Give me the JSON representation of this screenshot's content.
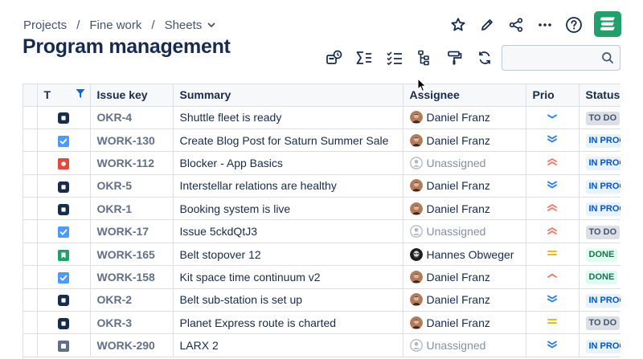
{
  "breadcrumb": {
    "items": [
      "Projects",
      "Fine work",
      "Sheets"
    ],
    "separator": "/"
  },
  "page_title": "Program management",
  "search": {
    "value": "",
    "placeholder": ""
  },
  "colors": {
    "brand_green": "#22A06B",
    "text": "#172B4D",
    "key_text": "#626F86",
    "unassigned": "#8590A2"
  },
  "columns": [
    "T",
    "Issue key",
    "Summary",
    "Assignee",
    "Prio",
    "Status"
  ],
  "rows": [
    {
      "type": "task-dark",
      "key": "OKR-4",
      "summary": "Shuttle fleet is ready",
      "assignee": "Daniel Franz",
      "avatar": "daniel",
      "prio": "low",
      "status": "TO DO",
      "status_kind": "todo"
    },
    {
      "type": "checked",
      "key": "WORK-130",
      "summary": "Create Blog Post for Saturn Summer Sale",
      "assignee": "Daniel Franz",
      "avatar": "daniel",
      "prio": "lowest",
      "status": "IN PROG",
      "status_kind": "progress"
    },
    {
      "type": "bug",
      "key": "WORK-112",
      "summary": "Blocker - App Basics",
      "assignee": "Unassigned",
      "avatar": "none",
      "prio": "highest",
      "status": "IN PROG",
      "status_kind": "progress"
    },
    {
      "type": "task-dark",
      "key": "OKR-5",
      "summary": "Interstellar relations are healthy",
      "assignee": "Daniel Franz",
      "avatar": "daniel",
      "prio": "lowest",
      "status": "IN PROG",
      "status_kind": "progress"
    },
    {
      "type": "task-dark",
      "key": "OKR-1",
      "summary": "Booking system is live",
      "assignee": "Daniel Franz",
      "avatar": "daniel",
      "prio": "highest",
      "status": "IN PROG",
      "status_kind": "progress"
    },
    {
      "type": "checked",
      "key": "WORK-17",
      "summary": "Issue 5ckdQtJ3",
      "assignee": "Unassigned",
      "avatar": "none",
      "prio": "highest",
      "status": "TO DO",
      "status_kind": "todo"
    },
    {
      "type": "story",
      "key": "WORK-165",
      "summary": "Belt stopover 12",
      "assignee": "Hannes Obweger",
      "avatar": "hannes",
      "prio": "medium",
      "status": "DONE",
      "status_kind": "done"
    },
    {
      "type": "checked",
      "key": "WORK-158",
      "summary": "Kit space time continuum v2",
      "assignee": "Daniel Franz",
      "avatar": "daniel",
      "prio": "high",
      "status": "DONE",
      "status_kind": "done"
    },
    {
      "type": "task-dark",
      "key": "OKR-2",
      "summary": "Belt sub-station is set up",
      "assignee": "Daniel Franz",
      "avatar": "daniel",
      "prio": "lowest",
      "status": "IN PROG",
      "status_kind": "progress"
    },
    {
      "type": "task-dark",
      "key": "OKR-3",
      "summary": "Planet Express route is charted",
      "assignee": "Daniel Franz",
      "avatar": "daniel",
      "prio": "medium",
      "status": "TO DO",
      "status_kind": "todo"
    },
    {
      "type": "task-grey",
      "key": "WORK-290",
      "summary": "LARX 2",
      "assignee": "Unassigned",
      "avatar": "none",
      "prio": "lowest",
      "status": "IN PROG",
      "status_kind": "progress"
    }
  ]
}
